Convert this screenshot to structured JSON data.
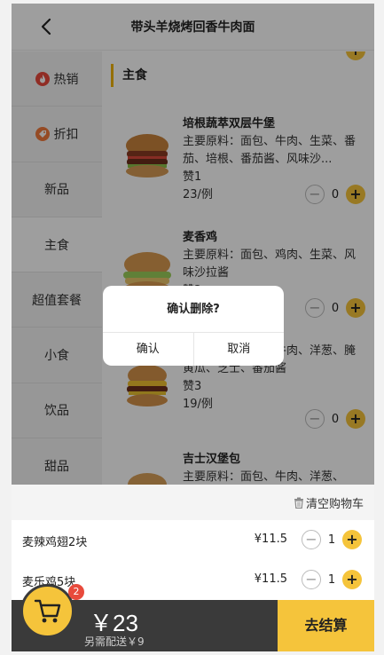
{
  "header": {
    "title": "带头羊烧烤回香牛肉面"
  },
  "sidebar": {
    "items": [
      {
        "label": "热销"
      },
      {
        "label": "折扣"
      },
      {
        "label": "新品"
      },
      {
        "label": "主食"
      },
      {
        "label": "超值套餐"
      },
      {
        "label": "小食"
      },
      {
        "label": "饮品"
      },
      {
        "label": "甜品"
      }
    ]
  },
  "section": {
    "title": "主食"
  },
  "foods": [
    {
      "name": "培根蔬萃双层牛堡",
      "desc": "主要原料：面包、牛肉、生菜、番茄、培根、番茄酱、风味沙...",
      "likes": "赞1",
      "price": "23/例",
      "count": "0"
    },
    {
      "name": "麦香鸡",
      "desc": "主要原料：面包、鸡肉、生菜、风味沙拉酱",
      "likes": "赞2",
      "price": "",
      "count": "0"
    },
    {
      "name": "",
      "desc": "主要原料：面包、牛肉、洋葱、腌黄瓜、芝士、番茄酱",
      "likes": "赞3",
      "price": "19/例",
      "count": "0"
    },
    {
      "name": "吉士汉堡包",
      "desc": "主要原料：面包、牛肉、洋葱、",
      "likes": "",
      "price": "",
      "count": ""
    }
  ],
  "dialog": {
    "title": "确认删除?",
    "confirm": "确认",
    "cancel": "取消"
  },
  "cart": {
    "clear_label": "清空购物车",
    "items": [
      {
        "name": "麦辣鸡翅2块",
        "price": "¥11.5",
        "count": "1"
      },
      {
        "name": "麦乐鸡5块",
        "price": "¥11.5",
        "count": "1"
      }
    ]
  },
  "bottom": {
    "total": "￥23",
    "delivery": "另需配送￥9",
    "checkout": "去结算",
    "badge": "2"
  },
  "colors": {
    "accent": "#f5c43b",
    "badge": "#e84a3c",
    "bar": "#3a3a3a"
  }
}
